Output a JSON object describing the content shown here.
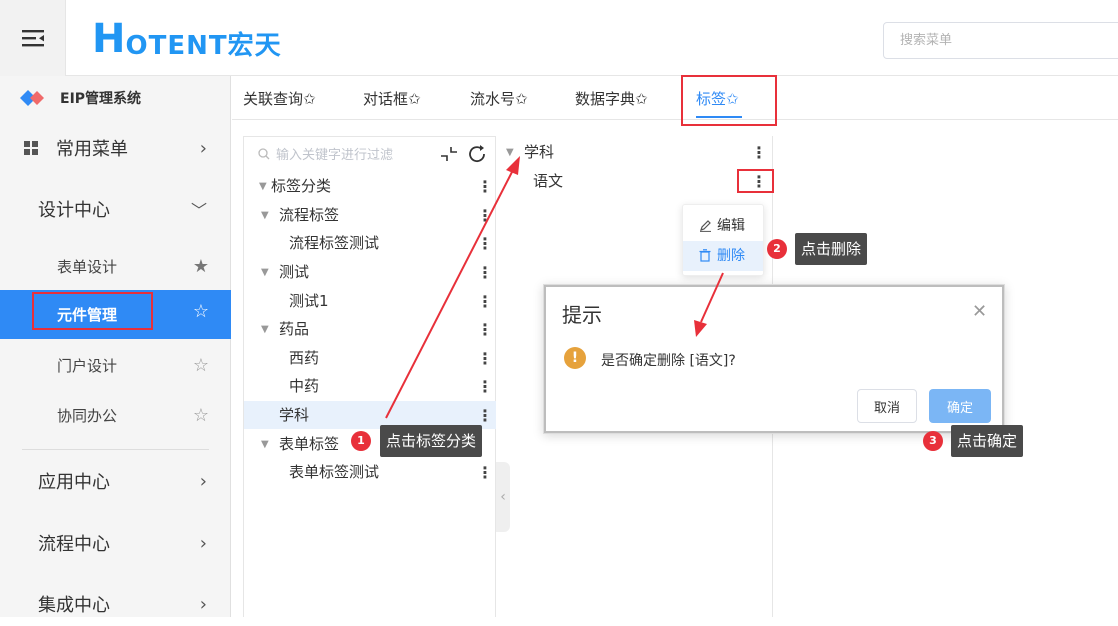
{
  "header": {
    "logo_letter": "H",
    "logo_text": "OTENT宏天",
    "search_placeholder": "搜索菜单"
  },
  "sidebar": {
    "system_name": "EIP管理系统",
    "items": [
      {
        "label": "常用菜单"
      },
      {
        "label": "设计中心"
      },
      {
        "label": "表单设计"
      },
      {
        "label": "元件管理"
      },
      {
        "label": "门户设计"
      },
      {
        "label": "协同办公"
      },
      {
        "label": "应用中心"
      },
      {
        "label": "流程中心"
      },
      {
        "label": "集成中心"
      }
    ]
  },
  "tabs": [
    {
      "label": "关联查询✩"
    },
    {
      "label": "对话框✩"
    },
    {
      "label": "流水号✩"
    },
    {
      "label": "数据字典✩"
    },
    {
      "label": "标签✩"
    }
  ],
  "tree": {
    "filter_placeholder": "输入关键字进行过滤",
    "nodes": [
      {
        "label": "标签分类"
      },
      {
        "label": "流程标签"
      },
      {
        "label": "流程标签测试"
      },
      {
        "label": "测试"
      },
      {
        "label": "测试1"
      },
      {
        "label": "药品"
      },
      {
        "label": "西药"
      },
      {
        "label": "中药"
      },
      {
        "label": "学科"
      },
      {
        "label": "表单标签"
      },
      {
        "label": "表单标签测试"
      }
    ]
  },
  "right_tree": {
    "nodes": [
      {
        "label": "学科"
      },
      {
        "label": "语文"
      }
    ]
  },
  "context_menu": {
    "edit": "编辑",
    "delete": "删除"
  },
  "dialog": {
    "title": "提示",
    "message": "是否确定删除 [语文]?",
    "cancel": "取消",
    "ok": "确定"
  },
  "annotations": {
    "step1": {
      "num": "1",
      "text": "点击标签分类"
    },
    "step2": {
      "num": "2",
      "text": "点击删除"
    },
    "step3": {
      "num": "3",
      "text": "点击确定"
    }
  },
  "colors": {
    "accent": "#2f8af5",
    "annotation_red": "#e8303a",
    "warning": "#e6a23c"
  }
}
